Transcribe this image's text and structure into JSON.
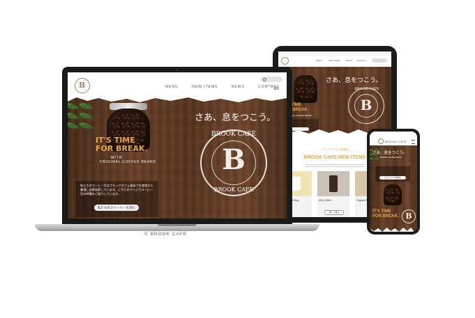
{
  "laptop": {
    "nav": [
      "MENU",
      "NEW ITEMS",
      "NEWS",
      "CONTACT"
    ],
    "logo_letter": "B",
    "heading_jp": "さあ、息をつこう。",
    "tagline_lines": [
      "IT'S TIME",
      "FOR BREAK."
    ],
    "sub_lines": [
      "WITH",
      "ORIGINAL COFFEE BEANS"
    ],
    "body_text": "私たちのコーヒー豆はブルックカフェ独自で生産地から厳選し自家焙煎しています。こちらのページでコーヒー豆の特徴をご紹介しています。",
    "cta_label": "私たちのストーリーを読む",
    "seal_text_top": "BROOK CAFE",
    "seal_text_bottom": "BROOK CAFE",
    "caption": "© BROOK CAFE"
  },
  "tablet": {
    "nav": [
      "MENU",
      "NEW ITEMS",
      "NEWS",
      "CONTACT"
    ],
    "heading_jp": "さあ、息をつこう。",
    "tagline_lines": [
      "IT'S TIME",
      "FOR BREAK."
    ],
    "sub_label": "ORIGINAL COFFEE BEANS",
    "seal_text_top": "BROOK CAFE",
    "section_small": "ブルックカフェ新商品",
    "section_title": "BROOK CAFE NEW ITEMS",
    "products": [
      "Brook Café Mug",
      "Drip Coffee",
      "Organic Beans"
    ],
    "product_button": "詳しく見る"
  },
  "phone": {
    "brand": "BROOK CAFE",
    "heading_jp": "さあ、息をつこう。",
    "tagline_lines": [
      "IT'S TIME",
      "FOR BREAK."
    ],
    "sub_label": "ORIGINAL COFFEE BEANS",
    "cta_label": "ストーリーを読む"
  },
  "colors": {
    "accent": "#e9a44a",
    "wood": "#5b3822",
    "nav_bg": "#ffffff",
    "device_frame": "#1b1b1b"
  }
}
